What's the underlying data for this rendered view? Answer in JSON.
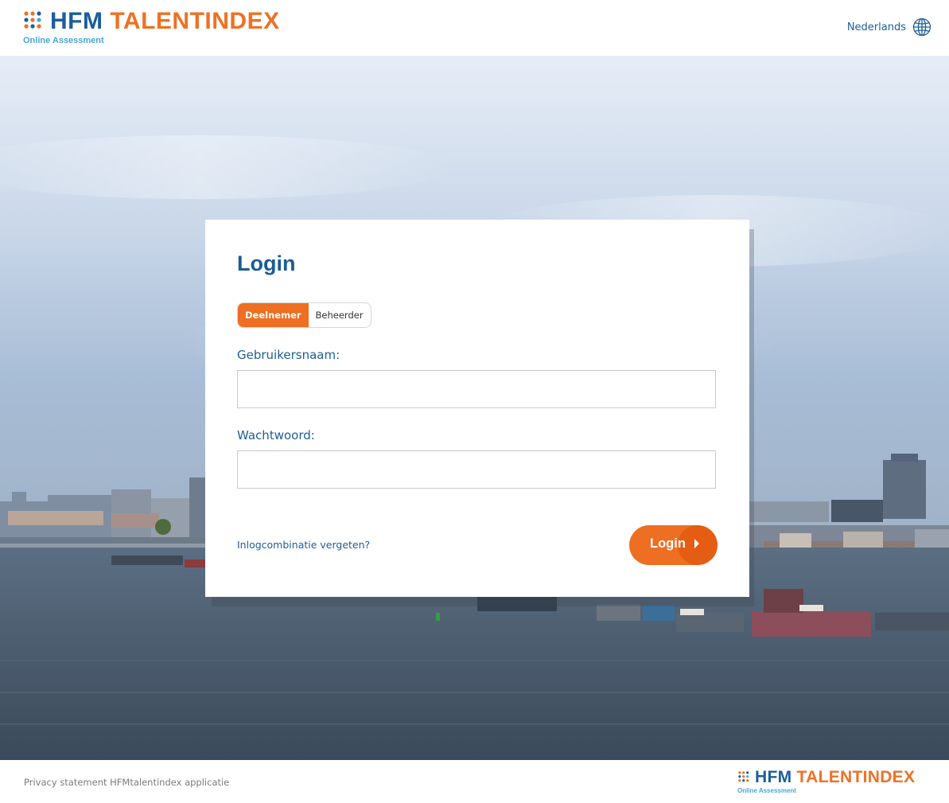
{
  "header": {
    "logo": {
      "brand": "HFM",
      "product": "TALENTINDEX",
      "tagline": "Online Assessment"
    },
    "language": {
      "label": "Nederlands",
      "icon": "globe-icon"
    }
  },
  "login": {
    "title": "Login",
    "roles": [
      {
        "label": "Deelnemer",
        "selected": true
      },
      {
        "label": "Beheerder",
        "selected": false
      }
    ],
    "username_label": "Gebruikersnaam:",
    "username_value": "",
    "password_label": "Wachtwoord:",
    "password_value": "",
    "forgot_link": "Inlogcombinatie vergeten?",
    "submit_label": "Login",
    "submit_icon": "chevron-right-icon"
  },
  "footer": {
    "privacy_link": "Privacy statement HFMtalentindex applicatie",
    "logo": {
      "brand": "HFM",
      "product": "TALENTINDEX",
      "tagline": "Online Assessment"
    }
  },
  "colors": {
    "brand_blue": "#1b5e9b",
    "brand_orange": "#ee7124",
    "accent_orange": "#ee6e22",
    "link_blue": "#1d5e96",
    "tagline_blue": "#49a6d9"
  }
}
